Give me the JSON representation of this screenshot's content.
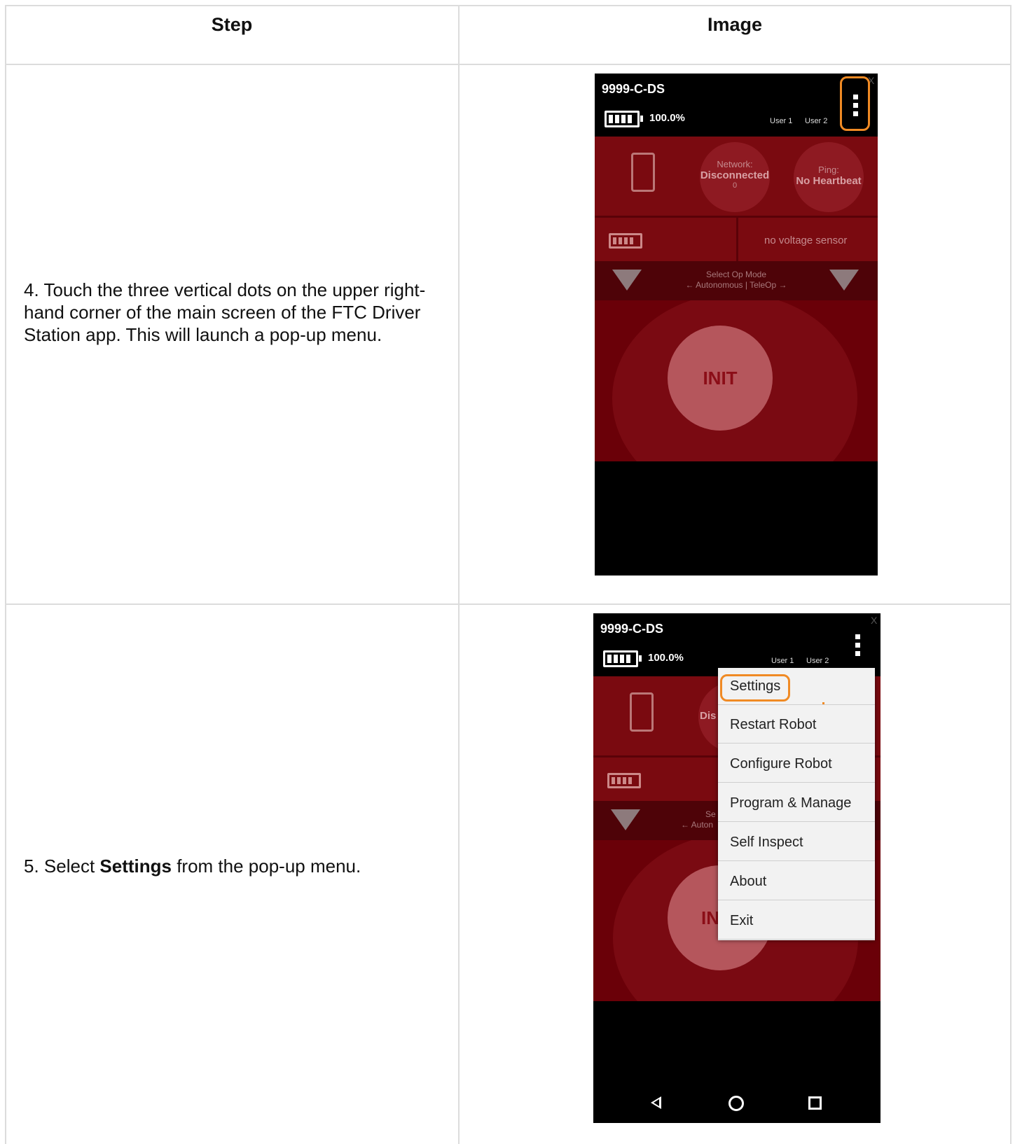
{
  "table": {
    "headers": {
      "step": "Step",
      "image": "Image"
    }
  },
  "rows": [
    {
      "step_text": "4. Touch the three vertical dots on the upper right-hand corner of the main screen of the FTC Driver Station app. This will launch a pop-up menu."
    },
    {
      "step_prefix": "5. Select ",
      "step_bold": "Settings",
      "step_suffix": " from the pop-up menu."
    }
  ],
  "phone": {
    "title": "9999-C-DS",
    "battery_pct": "100.0%",
    "user1": "User 1",
    "user2": "User 2",
    "close": "X",
    "network_label": "Network:",
    "network_status": "Disconnected",
    "network_value": "0",
    "ping_label": "Ping:",
    "ping_status": "No Heartbeat",
    "no_voltage": "no voltage sensor",
    "op_mode_title": "Select Op Mode",
    "op_mode_sub": "← Autonomous | TeleOp →",
    "init": "INIT",
    "partial_dis": "Dis",
    "partial_se": "Se",
    "partial_auton": "← Auton",
    "partial_in": "IN"
  },
  "menu": {
    "items": [
      "Settings",
      "Restart Robot",
      "Configure Robot",
      "Program & Manage",
      "Self Inspect",
      "About",
      "Exit"
    ]
  },
  "colors": {
    "highlight": "#f08a24",
    "app_red": "#7a0a10",
    "init_button": "#b5565c"
  }
}
